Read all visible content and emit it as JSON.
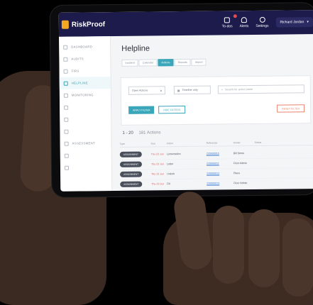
{
  "brand": {
    "name": "RiskProof"
  },
  "topbar": {
    "items": [
      {
        "label": "To-dos",
        "icon": "checklist-icon",
        "badge": ""
      },
      {
        "label": "Alerts",
        "icon": "bell-icon"
      },
      {
        "label": "Settings",
        "icon": "gear-icon"
      }
    ],
    "user": "Richard Jordan"
  },
  "sidebar": {
    "items": [
      {
        "label": "DASHBOARD",
        "active": false
      },
      {
        "label": "AUDITS",
        "active": false
      },
      {
        "label": "FIRS",
        "active": false
      },
      {
        "label": "HELPLINE",
        "active": true
      },
      {
        "label": "MONITORING",
        "active": false
      },
      {
        "label": "",
        "active": false
      },
      {
        "label": "",
        "active": false
      },
      {
        "label": "",
        "active": false
      },
      {
        "label": "ASSESSMENT",
        "active": false
      },
      {
        "label": "",
        "active": false
      },
      {
        "label": "",
        "active": false
      }
    ]
  },
  "main": {
    "title": "Helpline",
    "tabs": [
      {
        "label": "Incident",
        "active": false
      },
      {
        "label": "Calendar",
        "active": false
      },
      {
        "label": "Actions",
        "active": true
      },
      {
        "label": "Reports",
        "active": false
      },
      {
        "label": "Import",
        "active": false
      }
    ],
    "filters": {
      "select1": "Open Actions",
      "select2": "Timeline only",
      "search_placeholder": "Search for action name"
    },
    "buttons": {
      "apply": "APPLY FILTER",
      "hide": "HIDE FILTERS",
      "reset": "RESET FILTER"
    },
    "count": {
      "range": "1 - 20",
      "total": "181 Actions"
    },
    "table": {
      "headers": [
        "Type",
        "Due",
        "Action",
        "Reference",
        "Owner",
        "Status"
      ],
      "rows": [
        {
          "type": "ASSIGNMENT",
          "due": "Thu 23 Jun",
          "action": "Lamentation",
          "reference": "220000010",
          "owner": "Bill Stone"
        },
        {
          "type": "ASSIGNMENT",
          "due": "Thu 23 Jun",
          "action": "Letter",
          "reference": "220000011",
          "owner": "Floor Admin"
        },
        {
          "type": "ASSIGNMENT",
          "due": "Thu 23 Jun",
          "action": "Unlock",
          "reference": "220000012",
          "owner": "Plans"
        },
        {
          "type": "ASSIGNMENT",
          "due": "Thu 23 Jun",
          "action": "Fill",
          "reference": "220000013",
          "owner": "Floor Admin"
        }
      ]
    }
  }
}
